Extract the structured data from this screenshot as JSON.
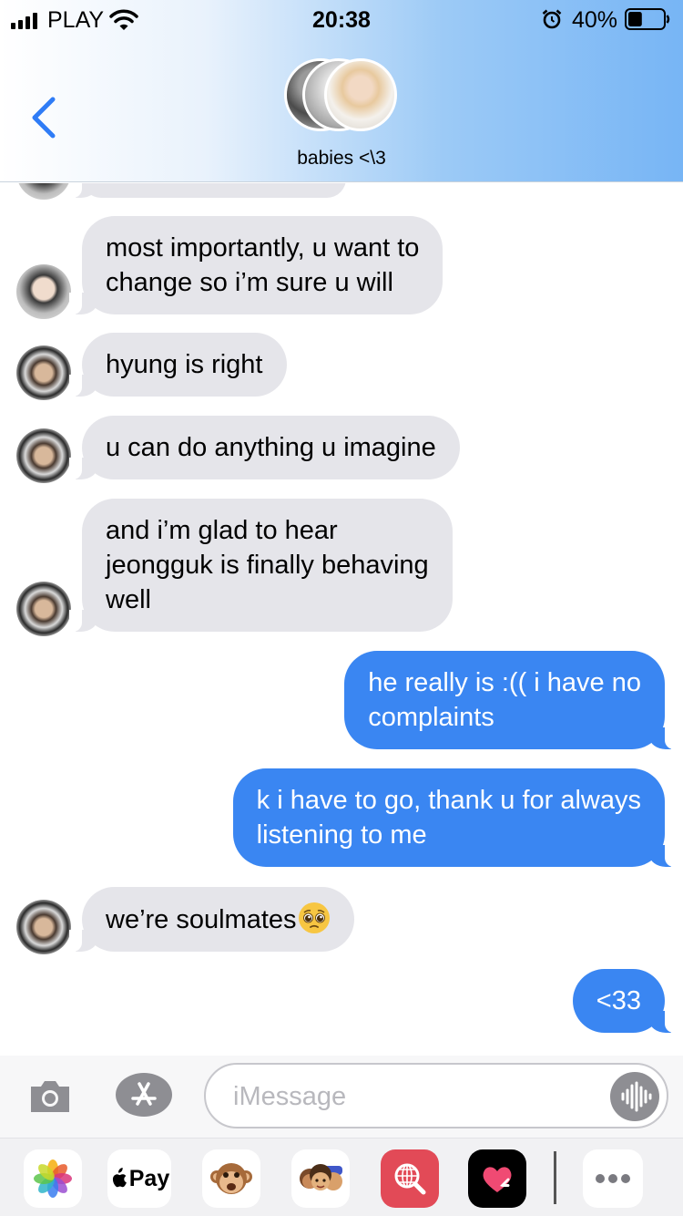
{
  "status_bar": {
    "carrier": "PLAY",
    "time": "20:38",
    "battery_percent": "40%",
    "battery_level": 0.4,
    "icons": [
      "signal-icon",
      "wifi-icon",
      "alarm-icon",
      "battery-icon"
    ]
  },
  "header": {
    "back_icon": "chevron-left-icon",
    "group_name": "babies <\\3",
    "group_avatar_count": 3
  },
  "messages": [
    {
      "side": "in",
      "text": "most importantly, u want to\nchange so i’m sure u will",
      "avatar": "jin"
    },
    {
      "side": "in",
      "text": "hyung is right",
      "avatar": "tae"
    },
    {
      "side": "in",
      "text": "u can do anything u imagine",
      "avatar": "tae"
    },
    {
      "side": "in",
      "text": "and i’m glad to hear\njeongguk is finally behaving\nwell",
      "avatar": "tae"
    },
    {
      "side": "out",
      "text": "he really is :(( i have no\ncomplaints"
    },
    {
      "side": "out",
      "text": "k i have to go, thank u for always\nlistening to me"
    },
    {
      "side": "in",
      "text": "we’re soulmates",
      "emoji": "pleading-face-emoji",
      "avatar": "tae"
    },
    {
      "side": "out",
      "text": "<33"
    }
  ],
  "compose": {
    "placeholder": "iMessage",
    "icons": [
      "camera-icon",
      "app-store-icon",
      "audio-waveform-icon"
    ]
  },
  "app_drawer": {
    "apple_pay_label": "Pay",
    "apps": [
      "photos-icon",
      "apple-pay-icon",
      "animoji-monkey-icon",
      "memoji-icon",
      "web-search-icon",
      "digital-touch-icon",
      "more-icon"
    ]
  },
  "colors": {
    "outgoing_bubble": "#3a86f2",
    "incoming_bubble": "#e5e5ea",
    "accent": "#2f7cf6"
  }
}
